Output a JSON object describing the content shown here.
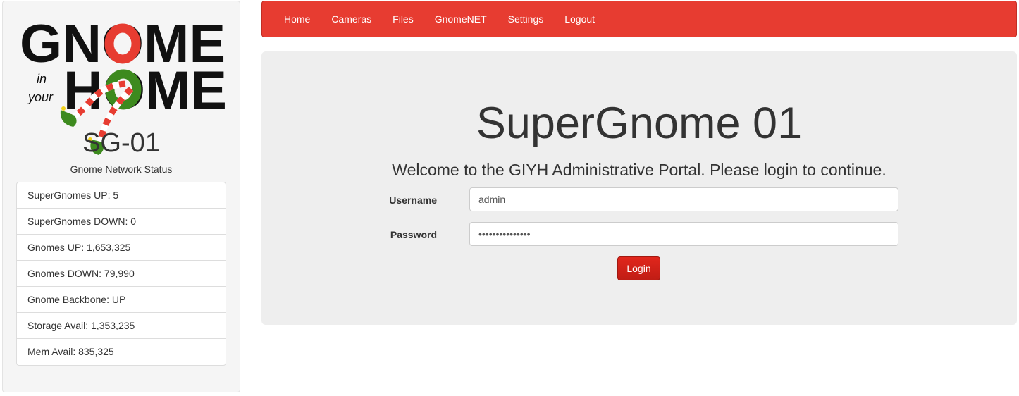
{
  "sidebar": {
    "logo": {
      "word_top": "GNOME",
      "word_in": "in",
      "word_your": "your",
      "word_bottom": "HOME",
      "colors": {
        "black": "#111111",
        "red": "#e73c31",
        "green": "#3d8a1e"
      }
    },
    "title": "SG-01",
    "status_heading": "Gnome Network Status",
    "status_items": [
      "SuperGnomes UP: 5",
      "SuperGnomes DOWN: 0",
      "Gnomes UP: 1,653,325",
      "Gnomes DOWN: 79,990",
      "Gnome Backbone: UP",
      "Storage Avail: 1,353,235",
      "Mem Avail: 835,325"
    ]
  },
  "navbar": {
    "color": "#e73c31",
    "items": [
      "Home",
      "Cameras",
      "Files",
      "GnomeNET",
      "Settings",
      "Logout"
    ]
  },
  "main": {
    "title": "SuperGnome 01",
    "welcome": "Welcome to the GIYH Administrative Portal. Please login to continue.",
    "form": {
      "username_label": "Username",
      "username_value": "admin",
      "password_label": "Password",
      "password_value": "SecretPassword1",
      "login_label": "Login"
    }
  }
}
